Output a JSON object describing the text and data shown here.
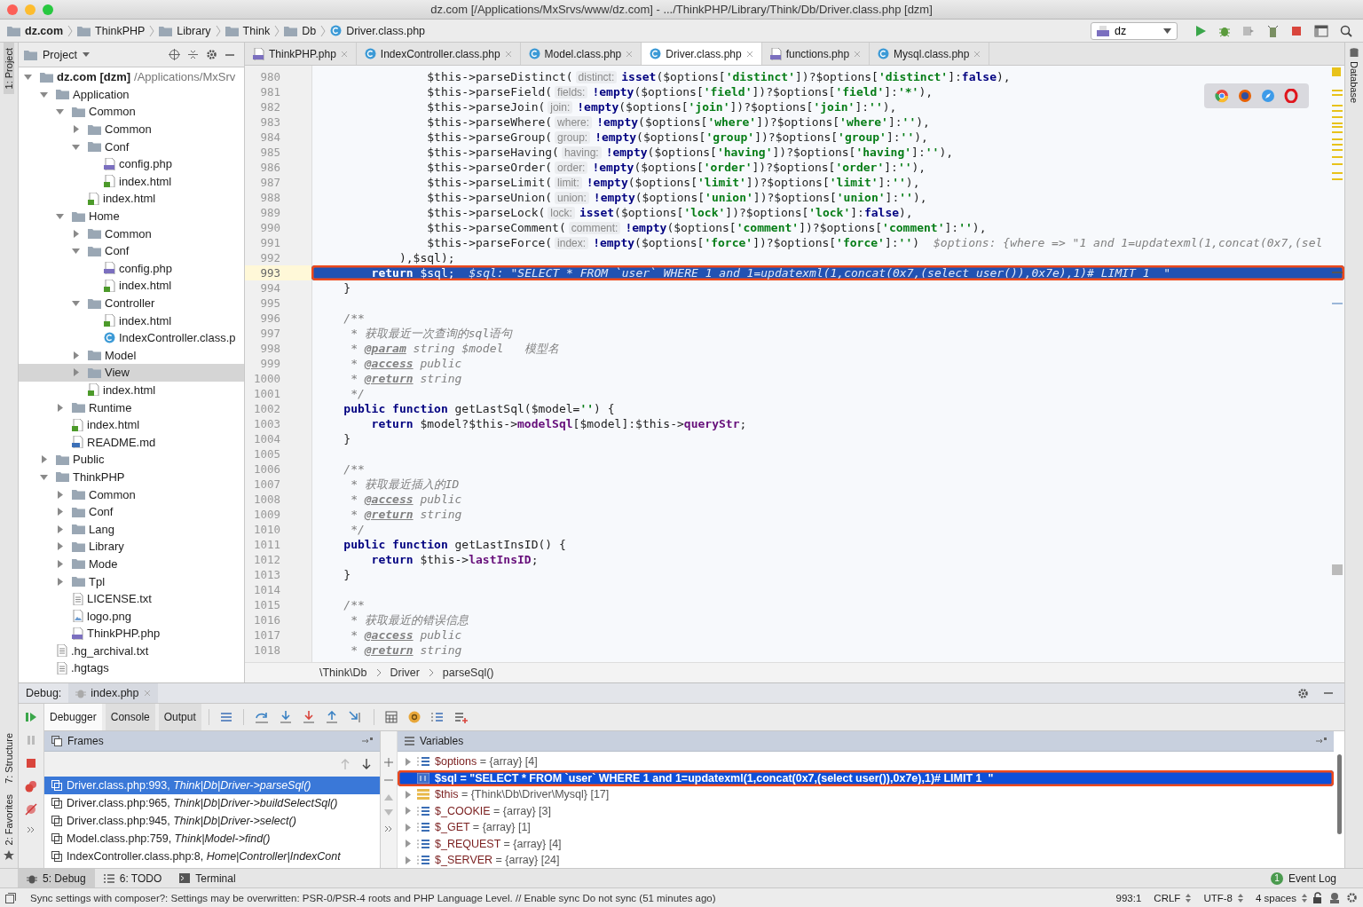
{
  "window": {
    "title": "dz.com [/Applications/MxSrvs/www/dz.com] - .../ThinkPHP/Library/Think/Db/Driver.class.php [dzm]"
  },
  "navigation_bar": {
    "path": [
      {
        "label": "dz.com",
        "kind": "project"
      },
      {
        "label": "ThinkPHP",
        "kind": "folder"
      },
      {
        "label": "Library",
        "kind": "folder"
      },
      {
        "label": "Think",
        "kind": "folder"
      },
      {
        "label": "Db",
        "kind": "folder"
      },
      {
        "label": "Driver.class.php",
        "kind": "class"
      }
    ],
    "run_configuration": "dz"
  },
  "side_strips": {
    "left_top": "1: Project",
    "left_bottom": [
      "7: Structure",
      "2: Favorites"
    ],
    "right": "Database"
  },
  "project_panel": {
    "title": "Project",
    "tree": [
      {
        "label": "dz.com [dzm]",
        "detail": "/Applications/MxSrv",
        "kind": "root",
        "expanded": true,
        "selected": false,
        "children": [
          {
            "label": "Application",
            "kind": "folder",
            "expanded": true,
            "selected": false,
            "children": [
              {
                "label": "Common",
                "kind": "folder",
                "expanded": true,
                "selected": false,
                "children": [
                  {
                    "label": "Common",
                    "kind": "folder",
                    "expanded": false,
                    "selected": false
                  },
                  {
                    "label": "Conf",
                    "kind": "folder",
                    "expanded": true,
                    "selected": false,
                    "children": [
                      {
                        "label": "config.php",
                        "kind": "php",
                        "selected": false
                      },
                      {
                        "label": "index.html",
                        "kind": "html",
                        "selected": false
                      }
                    ]
                  },
                  {
                    "label": "index.html",
                    "kind": "html",
                    "selected": false
                  }
                ]
              },
              {
                "label": "Home",
                "kind": "folder",
                "expanded": true,
                "selected": false,
                "children": [
                  {
                    "label": "Common",
                    "kind": "folder",
                    "expanded": false,
                    "selected": false
                  },
                  {
                    "label": "Conf",
                    "kind": "folder",
                    "expanded": true,
                    "selected": false,
                    "children": [
                      {
                        "label": "config.php",
                        "kind": "php",
                        "selected": false
                      },
                      {
                        "label": "index.html",
                        "kind": "html",
                        "selected": false
                      }
                    ]
                  },
                  {
                    "label": "Controller",
                    "kind": "folder",
                    "expanded": true,
                    "selected": false,
                    "children": [
                      {
                        "label": "index.html",
                        "kind": "html",
                        "selected": false
                      },
                      {
                        "label": "IndexController.class.p",
                        "kind": "class",
                        "selected": false
                      }
                    ]
                  },
                  {
                    "label": "Model",
                    "kind": "folder",
                    "expanded": false,
                    "selected": false
                  },
                  {
                    "label": "View",
                    "kind": "folder",
                    "expanded": false,
                    "selected": true
                  },
                  {
                    "label": "index.html",
                    "kind": "html",
                    "selected": false
                  }
                ]
              },
              {
                "label": "Runtime",
                "kind": "folder",
                "expanded": false,
                "selected": false
              },
              {
                "label": "index.html",
                "kind": "html",
                "selected": false
              },
              {
                "label": "README.md",
                "kind": "md",
                "selected": false
              }
            ]
          },
          {
            "label": "Public",
            "kind": "folder",
            "expanded": false,
            "selected": false
          },
          {
            "label": "ThinkPHP",
            "kind": "folder",
            "expanded": true,
            "selected": false,
            "children": [
              {
                "label": "Common",
                "kind": "folder",
                "expanded": false,
                "selected": false
              },
              {
                "label": "Conf",
                "kind": "folder",
                "expanded": false,
                "selected": false
              },
              {
                "label": "Lang",
                "kind": "folder",
                "expanded": false,
                "selected": false
              },
              {
                "label": "Library",
                "kind": "folder",
                "expanded": false,
                "selected": false
              },
              {
                "label": "Mode",
                "kind": "folder",
                "expanded": false,
                "selected": false
              },
              {
                "label": "Tpl",
                "kind": "folder",
                "expanded": false,
                "selected": false
              },
              {
                "label": "LICENSE.txt",
                "kind": "txt",
                "selected": false
              },
              {
                "label": "logo.png",
                "kind": "png",
                "selected": false
              },
              {
                "label": "ThinkPHP.php",
                "kind": "php",
                "selected": false
              }
            ]
          },
          {
            "label": ".hg_archival.txt",
            "kind": "txt",
            "selected": false
          },
          {
            "label": ".hgtags",
            "kind": "txt",
            "selected": false
          }
        ]
      }
    ]
  },
  "editor": {
    "tabs": [
      {
        "label": "ThinkPHP.php",
        "kind": "php",
        "selected": false
      },
      {
        "label": "IndexController.class.php",
        "kind": "class",
        "selected": false
      },
      {
        "label": "Model.class.php",
        "kind": "class",
        "selected": false
      },
      {
        "label": "Driver.class.php",
        "kind": "class",
        "selected": true
      },
      {
        "label": "functions.php",
        "kind": "php",
        "selected": false
      },
      {
        "label": "Mysql.class.php",
        "kind": "class",
        "selected": false
      }
    ],
    "lines": [
      {
        "number": "980",
        "current": false,
        "annotated": false,
        "tokens": [
          {
            "kind": "plain",
            "text": "                $this->parseDistinct("
          },
          {
            "kind": "hint",
            "text": "distinct:"
          },
          {
            "kind": "keyword",
            "text": "isset"
          },
          {
            "kind": "plain",
            "text": "($options["
          },
          {
            "kind": "string",
            "text": "'distinct'"
          },
          {
            "kind": "plain",
            "text": "])?$options["
          },
          {
            "kind": "string",
            "text": "'distinct'"
          },
          {
            "kind": "plain",
            "text": "]:"
          },
          {
            "kind": "keyword",
            "text": "false"
          },
          {
            "kind": "plain",
            "text": "),"
          }
        ]
      },
      {
        "number": "981",
        "current": false,
        "annotated": false,
        "tokens": [
          {
            "kind": "plain",
            "text": "                $this->parseField("
          },
          {
            "kind": "hint",
            "text": "fields:"
          },
          {
            "kind": "keyword",
            "text": "!empty"
          },
          {
            "kind": "plain",
            "text": "($options["
          },
          {
            "kind": "string",
            "text": "'field'"
          },
          {
            "kind": "plain",
            "text": "])?$options["
          },
          {
            "kind": "string",
            "text": "'field'"
          },
          {
            "kind": "plain",
            "text": "]:"
          },
          {
            "kind": "string",
            "text": "'*'"
          },
          {
            "kind": "plain",
            "text": "),"
          }
        ]
      },
      {
        "number": "982",
        "current": false,
        "annotated": false,
        "tokens": [
          {
            "kind": "plain",
            "text": "                $this->parseJoin("
          },
          {
            "kind": "hint",
            "text": "join:"
          },
          {
            "kind": "keyword",
            "text": "!empty"
          },
          {
            "kind": "plain",
            "text": "($options["
          },
          {
            "kind": "string",
            "text": "'join'"
          },
          {
            "kind": "plain",
            "text": "])?$options["
          },
          {
            "kind": "string",
            "text": "'join'"
          },
          {
            "kind": "plain",
            "text": "]:"
          },
          {
            "kind": "string",
            "text": "''"
          },
          {
            "kind": "plain",
            "text": "),"
          }
        ]
      },
      {
        "number": "983",
        "current": false,
        "annotated": false,
        "tokens": [
          {
            "kind": "plain",
            "text": "                $this->parseWhere("
          },
          {
            "kind": "hint",
            "text": "where:"
          },
          {
            "kind": "keyword",
            "text": "!empty"
          },
          {
            "kind": "plain",
            "text": "($options["
          },
          {
            "kind": "string",
            "text": "'where'"
          },
          {
            "kind": "plain",
            "text": "])?$options["
          },
          {
            "kind": "string",
            "text": "'where'"
          },
          {
            "kind": "plain",
            "text": "]:"
          },
          {
            "kind": "string",
            "text": "''"
          },
          {
            "kind": "plain",
            "text": "),"
          }
        ]
      },
      {
        "number": "984",
        "current": false,
        "annotated": false,
        "tokens": [
          {
            "kind": "plain",
            "text": "                $this->parseGroup("
          },
          {
            "kind": "hint",
            "text": "group:"
          },
          {
            "kind": "keyword",
            "text": "!empty"
          },
          {
            "kind": "plain",
            "text": "($options["
          },
          {
            "kind": "string",
            "text": "'group'"
          },
          {
            "kind": "plain",
            "text": "])?$options["
          },
          {
            "kind": "string",
            "text": "'group'"
          },
          {
            "kind": "plain",
            "text": "]:"
          },
          {
            "kind": "string",
            "text": "''"
          },
          {
            "kind": "plain",
            "text": "),"
          }
        ]
      },
      {
        "number": "985",
        "current": false,
        "annotated": false,
        "tokens": [
          {
            "kind": "plain",
            "text": "                $this->parseHaving("
          },
          {
            "kind": "hint",
            "text": "having:"
          },
          {
            "kind": "keyword",
            "text": "!empty"
          },
          {
            "kind": "plain",
            "text": "($options["
          },
          {
            "kind": "string",
            "text": "'having'"
          },
          {
            "kind": "plain",
            "text": "])?$options["
          },
          {
            "kind": "string",
            "text": "'having'"
          },
          {
            "kind": "plain",
            "text": "]:"
          },
          {
            "kind": "string",
            "text": "''"
          },
          {
            "kind": "plain",
            "text": "),"
          }
        ]
      },
      {
        "number": "986",
        "current": false,
        "annotated": false,
        "tokens": [
          {
            "kind": "plain",
            "text": "                $this->parseOrder("
          },
          {
            "kind": "hint",
            "text": "order:"
          },
          {
            "kind": "keyword",
            "text": "!empty"
          },
          {
            "kind": "plain",
            "text": "($options["
          },
          {
            "kind": "string",
            "text": "'order'"
          },
          {
            "kind": "plain",
            "text": "])?$options["
          },
          {
            "kind": "string",
            "text": "'order'"
          },
          {
            "kind": "plain",
            "text": "]:"
          },
          {
            "kind": "string",
            "text": "''"
          },
          {
            "kind": "plain",
            "text": "),"
          }
        ]
      },
      {
        "number": "987",
        "current": false,
        "annotated": false,
        "tokens": [
          {
            "kind": "plain",
            "text": "                $this->parseLimit("
          },
          {
            "kind": "hint",
            "text": "limit:"
          },
          {
            "kind": "keyword",
            "text": "!empty"
          },
          {
            "kind": "plain",
            "text": "($options["
          },
          {
            "kind": "string",
            "text": "'limit'"
          },
          {
            "kind": "plain",
            "text": "])?$options["
          },
          {
            "kind": "string",
            "text": "'limit'"
          },
          {
            "kind": "plain",
            "text": "]:"
          },
          {
            "kind": "string",
            "text": "''"
          },
          {
            "kind": "plain",
            "text": "),"
          }
        ]
      },
      {
        "number": "988",
        "current": false,
        "annotated": false,
        "tokens": [
          {
            "kind": "plain",
            "text": "                $this->parseUnion("
          },
          {
            "kind": "hint",
            "text": "union:"
          },
          {
            "kind": "keyword",
            "text": "!empty"
          },
          {
            "kind": "plain",
            "text": "($options["
          },
          {
            "kind": "string",
            "text": "'union'"
          },
          {
            "kind": "plain",
            "text": "])?$options["
          },
          {
            "kind": "string",
            "text": "'union'"
          },
          {
            "kind": "plain",
            "text": "]:"
          },
          {
            "kind": "string",
            "text": "''"
          },
          {
            "kind": "plain",
            "text": "),"
          }
        ]
      },
      {
        "number": "989",
        "current": false,
        "annotated": false,
        "tokens": [
          {
            "kind": "plain",
            "text": "                $this->parseLock("
          },
          {
            "kind": "hint",
            "text": "lock:"
          },
          {
            "kind": "keyword",
            "text": "isset"
          },
          {
            "kind": "plain",
            "text": "($options["
          },
          {
            "kind": "string",
            "text": "'lock'"
          },
          {
            "kind": "plain",
            "text": "])?$options["
          },
          {
            "kind": "string",
            "text": "'lock'"
          },
          {
            "kind": "plain",
            "text": "]:"
          },
          {
            "kind": "keyword",
            "text": "false"
          },
          {
            "kind": "plain",
            "text": "),"
          }
        ]
      },
      {
        "number": "990",
        "current": false,
        "annotated": false,
        "tokens": [
          {
            "kind": "plain",
            "text": "                $this->parseComment("
          },
          {
            "kind": "hint",
            "text": "comment:"
          },
          {
            "kind": "keyword",
            "text": "!empty"
          },
          {
            "kind": "plain",
            "text": "($options["
          },
          {
            "kind": "string",
            "text": "'comment'"
          },
          {
            "kind": "plain",
            "text": "])?$options["
          },
          {
            "kind": "string",
            "text": "'comment'"
          },
          {
            "kind": "plain",
            "text": "]:"
          },
          {
            "kind": "string",
            "text": "''"
          },
          {
            "kind": "plain",
            "text": "),"
          }
        ]
      },
      {
        "number": "991",
        "current": false,
        "annotated": false,
        "tokens": [
          {
            "kind": "plain",
            "text": "                $this->parseForce("
          },
          {
            "kind": "hint",
            "text": "index:"
          },
          {
            "kind": "keyword",
            "text": "!empty"
          },
          {
            "kind": "plain",
            "text": "($options["
          },
          {
            "kind": "string",
            "text": "'force'"
          },
          {
            "kind": "plain",
            "text": "])?$options["
          },
          {
            "kind": "string",
            "text": "'force'"
          },
          {
            "kind": "plain",
            "text": "]:"
          },
          {
            "kind": "string",
            "text": "''"
          },
          {
            "kind": "plain",
            "text": ")"
          },
          {
            "kind": "value",
            "text": "$options: {where => \"1 and 1=updatexml(1,concat(0x7,(sel"
          }
        ]
      },
      {
        "number": "992",
        "current": false,
        "annotated": false,
        "tokens": [
          {
            "kind": "plain",
            "text": "            ),$sql);"
          }
        ]
      },
      {
        "number": "993",
        "current": true,
        "annotated": true,
        "tokens": [
          {
            "kind": "keyword",
            "text": "        return"
          },
          {
            "kind": "plain",
            "text": " $sql;"
          },
          {
            "kind": "value",
            "text": "$sql: \"SELECT * FROM `user` WHERE 1 and 1=updatexml(1,concat(0x7,(select user()),0x7e),1)# LIMIT 1  \""
          }
        ]
      },
      {
        "number": "994",
        "current": false,
        "annotated": false,
        "tokens": [
          {
            "kind": "plain",
            "text": "    }"
          }
        ]
      },
      {
        "number": "995",
        "current": false,
        "annotated": false
      },
      {
        "number": "996",
        "current": false,
        "annotated": false,
        "tokens": [
          {
            "kind": "comment",
            "text": "    /**"
          }
        ]
      },
      {
        "number": "997",
        "current": false,
        "annotated": false,
        "tokens": [
          {
            "kind": "comment",
            "text": "     * 获取最近一次查询的sql语句"
          }
        ]
      },
      {
        "number": "998",
        "current": false,
        "annotated": false,
        "tokens": [
          {
            "kind": "comment",
            "text": "     * "
          },
          {
            "kind": "doctag",
            "text": "@param"
          },
          {
            "kind": "comment",
            "text": " string $model   模型名"
          }
        ]
      },
      {
        "number": "999",
        "current": false,
        "annotated": false,
        "tokens": [
          {
            "kind": "comment",
            "text": "     * "
          },
          {
            "kind": "doctag",
            "text": "@access"
          },
          {
            "kind": "comment",
            "text": " public"
          }
        ]
      },
      {
        "number": "1000",
        "current": false,
        "annotated": false,
        "tokens": [
          {
            "kind": "comment",
            "text": "     * "
          },
          {
            "kind": "doctag",
            "text": "@return"
          },
          {
            "kind": "comment",
            "text": " string"
          }
        ]
      },
      {
        "number": "1001",
        "current": false,
        "annotated": false,
        "tokens": [
          {
            "kind": "comment",
            "text": "     */"
          }
        ]
      },
      {
        "number": "1002",
        "current": false,
        "annotated": false,
        "tokens": [
          {
            "kind": "keyword",
            "text": "    public function"
          },
          {
            "kind": "plain",
            "text": " getLastSql($model="
          },
          {
            "kind": "string",
            "text": "''"
          },
          {
            "kind": "plain",
            "text": ") {"
          }
        ]
      },
      {
        "number": "1003",
        "current": false,
        "annotated": false,
        "tokens": [
          {
            "kind": "keyword",
            "text": "        return"
          },
          {
            "kind": "plain",
            "text": " $model?$this->"
          },
          {
            "kind": "field",
            "text": "modelSql"
          },
          {
            "kind": "plain",
            "text": "[$model]:$this->"
          },
          {
            "kind": "field",
            "text": "queryStr"
          },
          {
            "kind": "plain",
            "text": ";"
          }
        ]
      },
      {
        "number": "1004",
        "current": false,
        "annotated": false,
        "tokens": [
          {
            "kind": "plain",
            "text": "    }"
          }
        ]
      },
      {
        "number": "1005",
        "current": false,
        "annotated": false
      },
      {
        "number": "1006",
        "current": false,
        "annotated": false,
        "tokens": [
          {
            "kind": "comment",
            "text": "    /**"
          }
        ]
      },
      {
        "number": "1007",
        "current": false,
        "annotated": false,
        "tokens": [
          {
            "kind": "comment",
            "text": "     * 获取最近插入的ID"
          }
        ]
      },
      {
        "number": "1008",
        "current": false,
        "annotated": false,
        "tokens": [
          {
            "kind": "comment",
            "text": "     * "
          },
          {
            "kind": "doctag",
            "text": "@access"
          },
          {
            "kind": "comment",
            "text": " public"
          }
        ]
      },
      {
        "number": "1009",
        "current": false,
        "annotated": false,
        "tokens": [
          {
            "kind": "comment",
            "text": "     * "
          },
          {
            "kind": "doctag",
            "text": "@return"
          },
          {
            "kind": "comment",
            "text": " string"
          }
        ]
      },
      {
        "number": "1010",
        "current": false,
        "annotated": false,
        "tokens": [
          {
            "kind": "comment",
            "text": "     */"
          }
        ]
      },
      {
        "number": "1011",
        "current": false,
        "annotated": false,
        "tokens": [
          {
            "kind": "keyword",
            "text": "    public function"
          },
          {
            "kind": "plain",
            "text": " getLastInsID() {"
          }
        ]
      },
      {
        "number": "1012",
        "current": false,
        "annotated": false,
        "tokens": [
          {
            "kind": "keyword",
            "text": "        return"
          },
          {
            "kind": "plain",
            "text": " $this->"
          },
          {
            "kind": "field",
            "text": "lastInsID"
          },
          {
            "kind": "plain",
            "text": ";"
          }
        ]
      },
      {
        "number": "1013",
        "current": false,
        "annotated": false,
        "tokens": [
          {
            "kind": "plain",
            "text": "    }"
          }
        ]
      },
      {
        "number": "1014",
        "current": false,
        "annotated": false
      },
      {
        "number": "1015",
        "current": false,
        "annotated": false,
        "tokens": [
          {
            "kind": "comment",
            "text": "    /**"
          }
        ]
      },
      {
        "number": "1016",
        "current": false,
        "annotated": false,
        "tokens": [
          {
            "kind": "comment",
            "text": "     * 获取最近的错误信息"
          }
        ]
      },
      {
        "number": "1017",
        "current": false,
        "annotated": false,
        "tokens": [
          {
            "kind": "comment",
            "text": "     * "
          },
          {
            "kind": "doctag",
            "text": "@access"
          },
          {
            "kind": "comment",
            "text": " public"
          }
        ]
      },
      {
        "number": "1018",
        "current": false,
        "annotated": false,
        "tokens": [
          {
            "kind": "comment",
            "text": "     * "
          },
          {
            "kind": "doctag",
            "text": "@return"
          },
          {
            "kind": "comment",
            "text": " string"
          }
        ]
      }
    ],
    "breadcrumbs": [
      "\\Think\\Db",
      "Driver",
      "parseSql()"
    ]
  },
  "debug": {
    "label": "Debug:",
    "session_tab": "index.php",
    "tabs": [
      {
        "label": "Debugger",
        "selected": true
      },
      {
        "label": "Console",
        "selected": false
      },
      {
        "label": "Output",
        "selected": false
      }
    ],
    "frames_title": "Frames",
    "frames": [
      {
        "location": "Driver.class.php:993,",
        "method": "Think|Db|Driver->parseSql()",
        "selected": true
      },
      {
        "location": "Driver.class.php:965,",
        "method": "Think|Db|Driver->buildSelectSql()",
        "selected": false
      },
      {
        "location": "Driver.class.php:945,",
        "method": "Think|Db|Driver->select()",
        "selected": false
      },
      {
        "location": "Model.class.php:759,",
        "method": "Think|Model->find()",
        "selected": false
      },
      {
        "location": "IndexController.class.php:8,",
        "method": "Home|Controller|IndexCont",
        "selected": false
      }
    ],
    "variables_title": "Variables",
    "variables": [
      {
        "name": "$options",
        "value": "= {array} [4]",
        "kind": "array",
        "expandable": true,
        "selected": false,
        "annotated": false
      },
      {
        "name": "$sql",
        "value": "= \"SELECT * FROM `user` WHERE 1 and 1=updatexml(1,concat(0x7,(select user()),0x7e),1)# LIMIT 1  \"",
        "kind": "string",
        "expandable": false,
        "selected": true,
        "annotated": true
      },
      {
        "name": "$this",
        "value": "= {Think\\Db\\Driver\\Mysql} [17]",
        "kind": "object",
        "expandable": true,
        "selected": false,
        "annotated": false
      },
      {
        "name": "$_COOKIE",
        "value": "= {array} [3]",
        "kind": "array",
        "expandable": true,
        "selected": false,
        "annotated": false
      },
      {
        "name": "$_GET",
        "value": "= {array} [1]",
        "kind": "array",
        "expandable": true,
        "selected": false,
        "annotated": false
      },
      {
        "name": "$_REQUEST",
        "value": "= {array} [4]",
        "kind": "array",
        "expandable": true,
        "selected": false,
        "annotated": false
      },
      {
        "name": "$_SERVER",
        "value": "= {array} [24]",
        "kind": "array",
        "expandable": true,
        "selected": false,
        "annotated": false
      }
    ]
  },
  "bottom_bar": {
    "tabs": [
      {
        "label": "5: Debug",
        "kind": "debug",
        "selected": true
      },
      {
        "label": "6: TODO",
        "kind": "todo",
        "selected": false
      },
      {
        "label": "Terminal",
        "kind": "terminal",
        "selected": false
      }
    ],
    "event_log": {
      "label": "Event Log",
      "count": "1"
    }
  },
  "status_bar": {
    "message": "Sync settings with composer?: Settings may be overwritten: PSR-0/PSR-4 roots and PHP Language Level. // Enable sync Do not sync (51 minutes ago)",
    "items": [
      "993:1",
      "CRLF",
      "UTF-8",
      "4 spaces"
    ]
  }
}
